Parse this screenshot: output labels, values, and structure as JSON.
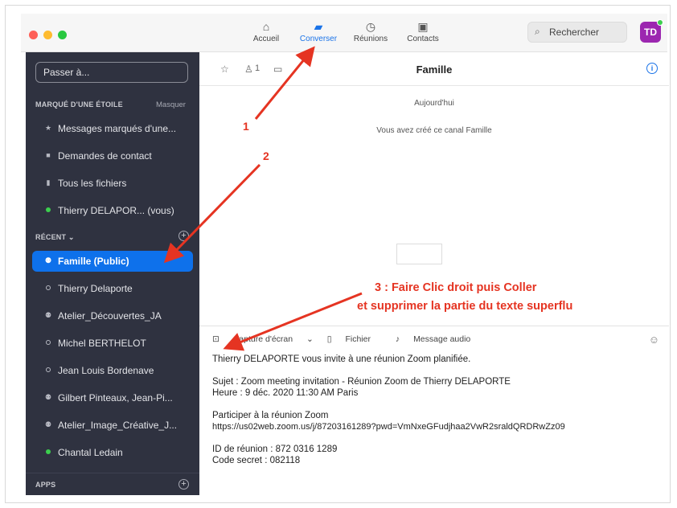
{
  "window": {
    "traffic_colors": [
      "#fe5f57",
      "#febb2e",
      "#29c840"
    ]
  },
  "topnav": {
    "items": [
      {
        "label": "Accueil",
        "icon": "home-icon"
      },
      {
        "label": "Converser",
        "icon": "chat-icon"
      },
      {
        "label": "Réunions",
        "icon": "clock-icon"
      },
      {
        "label": "Contacts",
        "icon": "contacts-icon"
      }
    ],
    "active": "Converser",
    "search_label": "Rechercher",
    "avatar_initials": "TD",
    "accent": "#1a73e8"
  },
  "sidebar": {
    "jump_placeholder": "Passer à...",
    "starred_header": "MARQUÉ D'UNE ÉTOILE",
    "starred_hide": "Masquer",
    "starred_items": [
      {
        "label": "Messages marqués d'une...",
        "icon": "star-icon"
      },
      {
        "label": "Demandes de contact",
        "icon": "contact-card-icon"
      },
      {
        "label": "Tous les fichiers",
        "icon": "file-icon"
      },
      {
        "label": "Thierry DELAPOR...  (vous)",
        "icon": "online-dot-icon"
      }
    ],
    "recent_header": "RÉCENT  ⌄",
    "recent_items": [
      {
        "label": "Famille  (Public)",
        "icon": "group-icon",
        "selected": true
      },
      {
        "label": "Thierry Delaporte",
        "icon": "offline-dot-icon"
      },
      {
        "label": "Atelier_Découvertes_JA",
        "icon": "group-icon"
      },
      {
        "label": "Michel BERTHELOT",
        "icon": "offline-dot-icon"
      },
      {
        "label": "Jean Louis Bordenave",
        "icon": "offline-dot-icon"
      },
      {
        "label": "Gilbert Pinteaux, Jean-Pi...",
        "icon": "group-icon"
      },
      {
        "label": "Atelier_Image_Créative_J...",
        "icon": "group-icon"
      },
      {
        "label": "Chantal Ledain",
        "icon": "online-dot-icon"
      }
    ],
    "apps_header": "APPS",
    "selected_color": "#0e71eb",
    "bg_color": "#2f3240"
  },
  "chat": {
    "header_count": "1",
    "title": "Famille",
    "date_label": "Aujourd'hui",
    "system_message": "Vous avez créé ce canal Famille"
  },
  "composer": {
    "tools": [
      {
        "label": "Capture d'écran",
        "icon": "screenshot-icon"
      },
      {
        "label": "Fichier",
        "icon": "file-icon"
      },
      {
        "label": "Message audio",
        "icon": "microphone-icon"
      }
    ],
    "lines": [
      "Thierry DELAPORTE vous invite à une réunion Zoom planifiée.",
      "",
      "Sujet : Zoom meeting invitation - Réunion Zoom de Thierry DELAPORTE",
      "Heure : 9 déc. 2020 11:30 AM Paris",
      "",
      "Participer à la réunion Zoom",
      "https://us02web.zoom.us/j/87203161289?pwd=VmNxeGFudjhaa2VwR2sraldQRDRwZz09",
      "",
      "ID de réunion : 872 0316 1289",
      "Code secret : 082118"
    ]
  },
  "annotations": {
    "label_1": "1",
    "label_2": "2",
    "label_3_line1": "3 : Faire Clic droit puis Coller",
    "label_3_line2": "et supprimer la partie du texte superflu",
    "color": "#e53422"
  }
}
